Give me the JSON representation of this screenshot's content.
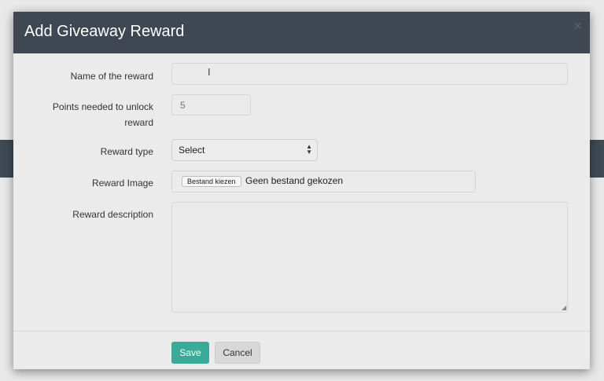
{
  "modal": {
    "title": "Add Giveaway Reward",
    "close_icon": "close-icon"
  },
  "form": {
    "name_label": "Name of the reward",
    "name_value": "",
    "points_label_line1": "Points needed to unlock",
    "points_label_line2": "reward",
    "points_placeholder": "5",
    "type_label": "Reward type",
    "type_selected": "Select",
    "image_label": "Reward Image",
    "file_button": "Bestand kiezen",
    "file_status": "Geen bestand gekozen",
    "description_label": "Reward description",
    "description_value": ""
  },
  "actions": {
    "save": "Save",
    "cancel": "Cancel"
  },
  "colors": {
    "header": "#3f4852",
    "save_button": "#3aab98"
  }
}
